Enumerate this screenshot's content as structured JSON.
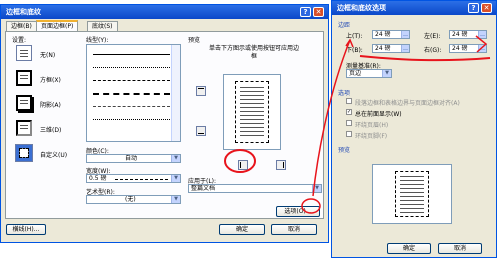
{
  "dialog1": {
    "title": "边框和底纹",
    "tabs": [
      "边框(B)",
      "页面边框(P)",
      "底纹(S)"
    ],
    "settings_label": "设置:",
    "settings": [
      "无(N)",
      "方框(X)",
      "阴影(A)",
      "三维(D)",
      "自定义(U)"
    ],
    "style_label": "线型(Y):",
    "color_label": "颜色(C):",
    "color_value": "自动",
    "width_label": "宽度(W):",
    "width_value": "0.5 磅",
    "art_label": "艺术型(R):",
    "art_value": "(无)",
    "preview_label": "预览",
    "preview_hint": "单击下方图示或使用按钮可应用边框",
    "apply_label": "应用于(L):",
    "apply_value": "整篇文档",
    "options_button": "选项(O)...",
    "toolbar_button": "横线(H)...",
    "ok_button": "确定",
    "cancel_button": "取消",
    "help_glyph": "?",
    "close_glyph": "✕"
  },
  "dialog2": {
    "title": "边框和底纹选项",
    "margin_section": "边距",
    "top_label": "上(T):",
    "top_value": "24 磅",
    "left_label": "左(E):",
    "left_value": "24 磅",
    "bottom_label": "下(B):",
    "bottom_value": "24 磅",
    "right_label": "右(G):",
    "right_value": "24 磅",
    "measure_label": "测量基准(R):",
    "measure_value": "页边",
    "options_section": "选项",
    "options": [
      {
        "label": "段落边框和表格边界与页面边框对齐(A)",
        "checked": false
      },
      {
        "label": "总在前面显示(W)",
        "checked": true
      },
      {
        "label": "环绕页眉(H)",
        "checked": false
      },
      {
        "label": "环绕页脚(F)",
        "checked": false
      }
    ],
    "preview_label": "预览",
    "ok_button": "确定",
    "cancel_button": "取消",
    "help_glyph": "?",
    "close_glyph": "✕"
  },
  "annotations": {
    "color": "#e8141c"
  }
}
